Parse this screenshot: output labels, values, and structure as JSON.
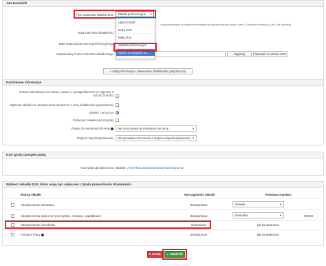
{
  "main_panel": {
    "title": "Jan Kowalski",
    "plan_label": "Plan opłacania składek ZUS",
    "plan_selected": "Składki preferencyjne",
    "plan_options": [
      "Ulga na start",
      "Duży ZUS",
      "Mały ZUS",
      "Składki preferencyjne",
      "Niższe ze względu na ..."
    ],
    "side_note": "...rozpoczynającej prowadzenie działalności gospodarczej przez okres 24 pełnych miesięcy. (Art. Na zakresy)",
    "date_start_label": "Data założenia działalności",
    "date_pref_label": "Data rozpoczęcia okresu preferencyjnego",
    "account_label": "Indywidualny numer rachunku składkowego",
    "wyjasnij_btn": "Wyjaśnij",
    "sprawdz_btn": "Sprawdź na stronie ZUS",
    "add_info_btn": "+ dodaj informacje o zawieszeniu działalności gospodarczej"
  },
  "extra_panel": {
    "title": "Dodatkowe informacje",
    "q1": "Jestem zatrudniony na umowę o pracę z wynagrodzeniem co najmniej 3 010,00 zł brutto",
    "q2": "Opłacam składki na ubezpieczenia społeczne z innej działalności gospodarczej",
    "q3": "Zawieś z przyczyn",
    "q4": "Pobieram zasiłek macierzyński",
    "pension_label": "Prawo do emerytury lub renty",
    "pension_value": "Nie mam prawa do emerytury lub renty",
    "disability_label": "Stopień niepełnosprawności",
    "disability_value": "Nie posiadam orzeczenia o stopniu niepełnosprawności"
  },
  "code_panel": {
    "title": "Kod tytułu ubezpieczenia",
    "row_label": "Kod tytułu ubezpieczenia",
    "code": "054000",
    "change_link": "zmień kod podstawowy",
    "auto_link": "ustal automatycznie"
  },
  "contrib_panel": {
    "title": "Wybierz składki ZUS, które mają być opłacane z tytułu prowadzenia działalności",
    "headers": [
      "Rodzaj składki",
      "Wymagalność składki",
      "Podstawa wymiaru"
    ],
    "rows": [
      {
        "name": "Ubezpieczenie zdrowotne",
        "status": "obowiązkowe",
        "base": "złotówki",
        "amount": ""
      },
      {
        "name": "Ubezpieczenia społeczne (emerytalne, rentowe, wypadkowe)",
        "status": "obowiązkowe",
        "base": "minimalna",
        "amount": "903,00"
      },
      {
        "name": "Ubezpieczenie chorobowe",
        "status": "dobrowolne",
        "base": "jak za społeczne",
        "amount": ""
      },
      {
        "name": "Fundusz Pracy",
        "status": "niedotyczone",
        "base": "jak za społeczne",
        "amount": ""
      }
    ]
  },
  "footer": {
    "cancel": "✕ anuluj",
    "save": "✓ zatwierdź"
  },
  "colors": {
    "highlight": "#d6222f",
    "accent": "#3f7fd4",
    "save_green": "#3c9a3c",
    "cancel_red": "#d9383a"
  }
}
